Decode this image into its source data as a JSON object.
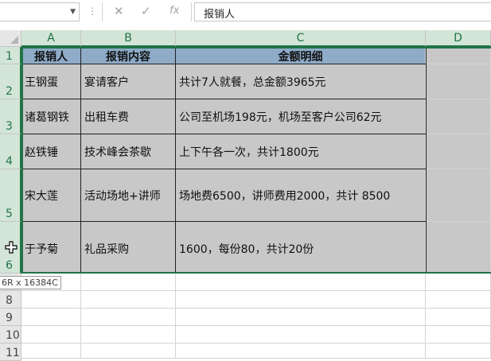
{
  "formula_bar": {
    "name_box": "",
    "cancel_icon": "✕",
    "enter_icon": "✓",
    "fx_label": "fx",
    "formula": "报销人"
  },
  "columns": [
    "A",
    "B",
    "C",
    "D"
  ],
  "rows": [
    "1",
    "2",
    "3",
    "4",
    "5",
    "6",
    "8",
    "9",
    "10",
    "11"
  ],
  "table": {
    "headers": [
      "报销人",
      "报销内容",
      "金额明细"
    ],
    "rows": [
      [
        "王钢蛋",
        "宴请客户",
        "共计7人就餐，总金额3965元"
      ],
      [
        "诸葛钢铁",
        "出租车费",
        "公司至机场198元，机场至客户公司62元"
      ],
      [
        "赵铁锤",
        "技术峰会茶歇",
        "上下午各一次，共计1800元"
      ],
      [
        "宋大莲",
        "活动场地+讲师",
        "场地费6500，讲师费用2000，共计 8500"
      ],
      [
        "于予菊",
        "礼品采购",
        "1600，每份80，共计20份"
      ]
    ]
  },
  "selection_tooltip": "6R x 16384C",
  "colors": {
    "header_fill": "#8eabc8",
    "selection_shade": "#c8c8c8",
    "selection_border": "#217346"
  }
}
